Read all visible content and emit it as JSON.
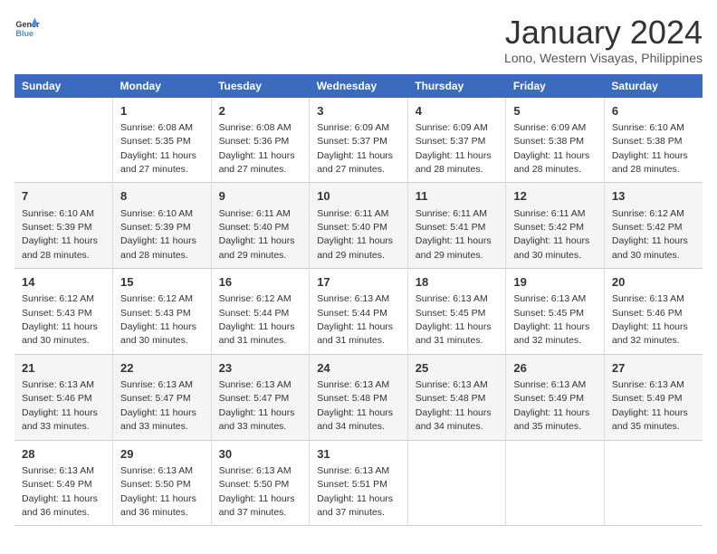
{
  "logo": {
    "general": "General",
    "blue": "Blue"
  },
  "header": {
    "title": "January 2024",
    "subtitle": "Lono, Western Visayas, Philippines"
  },
  "columns": [
    "Sunday",
    "Monday",
    "Tuesday",
    "Wednesday",
    "Thursday",
    "Friday",
    "Saturday"
  ],
  "weeks": [
    {
      "cells": [
        {
          "day": "",
          "sunrise": "",
          "sunset": "",
          "daylight": ""
        },
        {
          "day": "1",
          "sunrise": "Sunrise: 6:08 AM",
          "sunset": "Sunset: 5:35 PM",
          "daylight": "Daylight: 11 hours and 27 minutes."
        },
        {
          "day": "2",
          "sunrise": "Sunrise: 6:08 AM",
          "sunset": "Sunset: 5:36 PM",
          "daylight": "Daylight: 11 hours and 27 minutes."
        },
        {
          "day": "3",
          "sunrise": "Sunrise: 6:09 AM",
          "sunset": "Sunset: 5:37 PM",
          "daylight": "Daylight: 11 hours and 27 minutes."
        },
        {
          "day": "4",
          "sunrise": "Sunrise: 6:09 AM",
          "sunset": "Sunset: 5:37 PM",
          "daylight": "Daylight: 11 hours and 28 minutes."
        },
        {
          "day": "5",
          "sunrise": "Sunrise: 6:09 AM",
          "sunset": "Sunset: 5:38 PM",
          "daylight": "Daylight: 11 hours and 28 minutes."
        },
        {
          "day": "6",
          "sunrise": "Sunrise: 6:10 AM",
          "sunset": "Sunset: 5:38 PM",
          "daylight": "Daylight: 11 hours and 28 minutes."
        }
      ]
    },
    {
      "cells": [
        {
          "day": "7",
          "sunrise": "Sunrise: 6:10 AM",
          "sunset": "Sunset: 5:39 PM",
          "daylight": "Daylight: 11 hours and 28 minutes."
        },
        {
          "day": "8",
          "sunrise": "Sunrise: 6:10 AM",
          "sunset": "Sunset: 5:39 PM",
          "daylight": "Daylight: 11 hours and 28 minutes."
        },
        {
          "day": "9",
          "sunrise": "Sunrise: 6:11 AM",
          "sunset": "Sunset: 5:40 PM",
          "daylight": "Daylight: 11 hours and 29 minutes."
        },
        {
          "day": "10",
          "sunrise": "Sunrise: 6:11 AM",
          "sunset": "Sunset: 5:40 PM",
          "daylight": "Daylight: 11 hours and 29 minutes."
        },
        {
          "day": "11",
          "sunrise": "Sunrise: 6:11 AM",
          "sunset": "Sunset: 5:41 PM",
          "daylight": "Daylight: 11 hours and 29 minutes."
        },
        {
          "day": "12",
          "sunrise": "Sunrise: 6:11 AM",
          "sunset": "Sunset: 5:42 PM",
          "daylight": "Daylight: 11 hours and 30 minutes."
        },
        {
          "day": "13",
          "sunrise": "Sunrise: 6:12 AM",
          "sunset": "Sunset: 5:42 PM",
          "daylight": "Daylight: 11 hours and 30 minutes."
        }
      ]
    },
    {
      "cells": [
        {
          "day": "14",
          "sunrise": "Sunrise: 6:12 AM",
          "sunset": "Sunset: 5:43 PM",
          "daylight": "Daylight: 11 hours and 30 minutes."
        },
        {
          "day": "15",
          "sunrise": "Sunrise: 6:12 AM",
          "sunset": "Sunset: 5:43 PM",
          "daylight": "Daylight: 11 hours and 30 minutes."
        },
        {
          "day": "16",
          "sunrise": "Sunrise: 6:12 AM",
          "sunset": "Sunset: 5:44 PM",
          "daylight": "Daylight: 11 hours and 31 minutes."
        },
        {
          "day": "17",
          "sunrise": "Sunrise: 6:13 AM",
          "sunset": "Sunset: 5:44 PM",
          "daylight": "Daylight: 11 hours and 31 minutes."
        },
        {
          "day": "18",
          "sunrise": "Sunrise: 6:13 AM",
          "sunset": "Sunset: 5:45 PM",
          "daylight": "Daylight: 11 hours and 31 minutes."
        },
        {
          "day": "19",
          "sunrise": "Sunrise: 6:13 AM",
          "sunset": "Sunset: 5:45 PM",
          "daylight": "Daylight: 11 hours and 32 minutes."
        },
        {
          "day": "20",
          "sunrise": "Sunrise: 6:13 AM",
          "sunset": "Sunset: 5:46 PM",
          "daylight": "Daylight: 11 hours and 32 minutes."
        }
      ]
    },
    {
      "cells": [
        {
          "day": "21",
          "sunrise": "Sunrise: 6:13 AM",
          "sunset": "Sunset: 5:46 PM",
          "daylight": "Daylight: 11 hours and 33 minutes."
        },
        {
          "day": "22",
          "sunrise": "Sunrise: 6:13 AM",
          "sunset": "Sunset: 5:47 PM",
          "daylight": "Daylight: 11 hours and 33 minutes."
        },
        {
          "day": "23",
          "sunrise": "Sunrise: 6:13 AM",
          "sunset": "Sunset: 5:47 PM",
          "daylight": "Daylight: 11 hours and 33 minutes."
        },
        {
          "day": "24",
          "sunrise": "Sunrise: 6:13 AM",
          "sunset": "Sunset: 5:48 PM",
          "daylight": "Daylight: 11 hours and 34 minutes."
        },
        {
          "day": "25",
          "sunrise": "Sunrise: 6:13 AM",
          "sunset": "Sunset: 5:48 PM",
          "daylight": "Daylight: 11 hours and 34 minutes."
        },
        {
          "day": "26",
          "sunrise": "Sunrise: 6:13 AM",
          "sunset": "Sunset: 5:49 PM",
          "daylight": "Daylight: 11 hours and 35 minutes."
        },
        {
          "day": "27",
          "sunrise": "Sunrise: 6:13 AM",
          "sunset": "Sunset: 5:49 PM",
          "daylight": "Daylight: 11 hours and 35 minutes."
        }
      ]
    },
    {
      "cells": [
        {
          "day": "28",
          "sunrise": "Sunrise: 6:13 AM",
          "sunset": "Sunset: 5:49 PM",
          "daylight": "Daylight: 11 hours and 36 minutes."
        },
        {
          "day": "29",
          "sunrise": "Sunrise: 6:13 AM",
          "sunset": "Sunset: 5:50 PM",
          "daylight": "Daylight: 11 hours and 36 minutes."
        },
        {
          "day": "30",
          "sunrise": "Sunrise: 6:13 AM",
          "sunset": "Sunset: 5:50 PM",
          "daylight": "Daylight: 11 hours and 37 minutes."
        },
        {
          "day": "31",
          "sunrise": "Sunrise: 6:13 AM",
          "sunset": "Sunset: 5:51 PM",
          "daylight": "Daylight: 11 hours and 37 minutes."
        },
        {
          "day": "",
          "sunrise": "",
          "sunset": "",
          "daylight": ""
        },
        {
          "day": "",
          "sunrise": "",
          "sunset": "",
          "daylight": ""
        },
        {
          "day": "",
          "sunrise": "",
          "sunset": "",
          "daylight": ""
        }
      ]
    }
  ]
}
